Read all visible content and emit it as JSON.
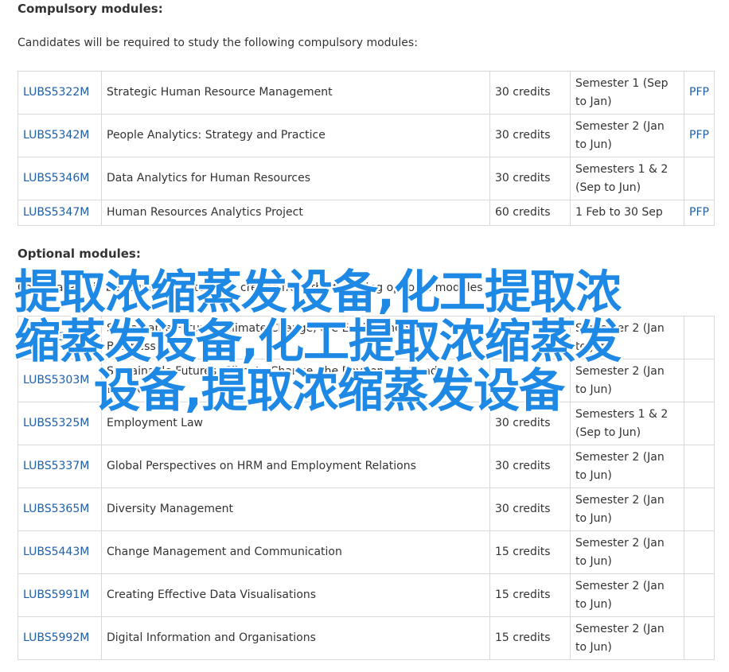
{
  "compulsory": {
    "heading": "Compulsory modules:",
    "intro": "Candidates will be required to study the following compulsory modules:",
    "rows": [
      {
        "code": "LUBS5322M",
        "title": "Strategic Human Resource Management",
        "credits": "30 credits",
        "semester": "Semester 1 (Sep to Jan)",
        "pfp": "PFP"
      },
      {
        "code": "LUBS5342M",
        "title": "People Analytics: Strategy and Practice",
        "credits": "30 credits",
        "semester": "Semester 2 (Jan to Jun)",
        "pfp": "PFP"
      },
      {
        "code": "LUBS5346M",
        "title": "Data Analytics for Human Resources",
        "credits": "30 credits",
        "semester": "Semesters 1 & 2 (Sep to Jun)",
        "pfp": ""
      },
      {
        "code": "LUBS5347M",
        "title": "Human Resources Analytics Project",
        "credits": "60 credits",
        "semester": "1 Feb to 30 Sep",
        "pfp": "PFP"
      }
    ]
  },
  "optional": {
    "heading": "Optional modules:",
    "intro": "Candidates will be required to study 30 credits from the following optional modules",
    "rows": [
      {
        "code": "LUBS5301M",
        "title": "Sustainable Futures: Climate Change, the Environment and Business",
        "credits": "",
        "semester": "Semester 2 (Jan to Jun)",
        "pfp": ""
      },
      {
        "code": "LUBS5303M",
        "title": "Sustainable Futures: Climate Change, the Environment and Business",
        "credits": "",
        "semester": "Semester 2 (Jan to Jun)",
        "pfp": ""
      },
      {
        "code": "LUBS5325M",
        "title": "Employment Law",
        "credits": "30 credits",
        "semester": "Semesters 1 & 2 (Sep to Jun)",
        "pfp": ""
      },
      {
        "code": "LUBS5337M",
        "title": "Global Perspectives on HRM and Employment Relations",
        "credits": "30 credits",
        "semester": "Semester 2 (Jan to Jun)",
        "pfp": ""
      },
      {
        "code": "LUBS5365M",
        "title": "Diversity Management",
        "credits": "30 credits",
        "semester": "Semester 2 (Jan to Jun)",
        "pfp": ""
      },
      {
        "code": "LUBS5443M",
        "title": "Change Management and Communication",
        "credits": "15 credits",
        "semester": "Semester 2 (Jan to Jun)",
        "pfp": ""
      },
      {
        "code": "LUBS5991M",
        "title": "Creating Effective Data Visualisations",
        "credits": "15 credits",
        "semester": "Semester 2 (Jan to Jun)",
        "pfp": ""
      },
      {
        "code": "LUBS5992M",
        "title": "Digital Information and Organisations",
        "credits": "15 credits",
        "semester": "Semester 2 (Jan to Jun)",
        "pfp": ""
      }
    ]
  },
  "watermark": {
    "line1": "提取浓缩蒸发设备,化工提取浓",
    "line2": "缩蒸发设备,化工提取浓缩蒸发",
    "line3": "设备,提取浓缩蒸发设备",
    "color": "#1e88e5"
  },
  "colors": {
    "link": "#1f5fa8",
    "border": "#d8d8d8",
    "text": "#333333"
  }
}
